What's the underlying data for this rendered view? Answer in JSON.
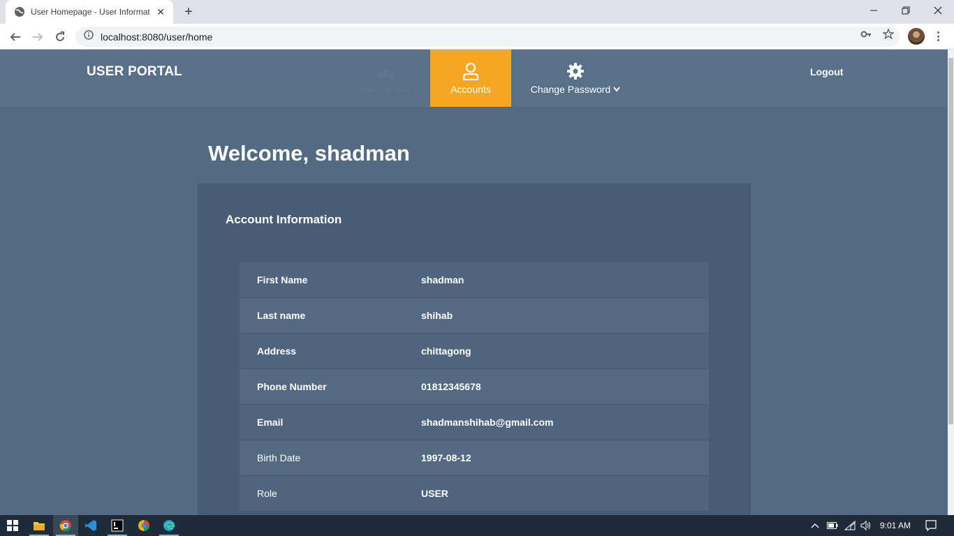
{
  "browser": {
    "tab_title": "User Homepage - User Informati",
    "url": "localhost:8080/user/home"
  },
  "nav": {
    "brand": "USER PORTAL",
    "items": [
      {
        "label": "Dashboard",
        "icon": "dashboard-gauge-icon"
      },
      {
        "label": "Accounts",
        "icon": "user-icon",
        "active": true
      },
      {
        "label": "Change Password",
        "icon": "gear-icon"
      }
    ],
    "logout": "Logout",
    "accent_color": "#f5a623"
  },
  "main": {
    "welcome": "Welcome, shadman",
    "card_title": "Account Information",
    "rows": [
      {
        "label": "First Name",
        "value": "shadman"
      },
      {
        "label": "Last name",
        "value": "shihab"
      },
      {
        "label": "Address",
        "value": "chittagong"
      },
      {
        "label": "Phone Number",
        "value": "01812345678"
      },
      {
        "label": "Email",
        "value": "shadmanshihab@gmail.com"
      },
      {
        "label": "Birth Date",
        "value": "1997-08-12"
      },
      {
        "label": "Role",
        "value": "USER"
      }
    ]
  },
  "taskbar": {
    "clock": "9:01 AM"
  }
}
